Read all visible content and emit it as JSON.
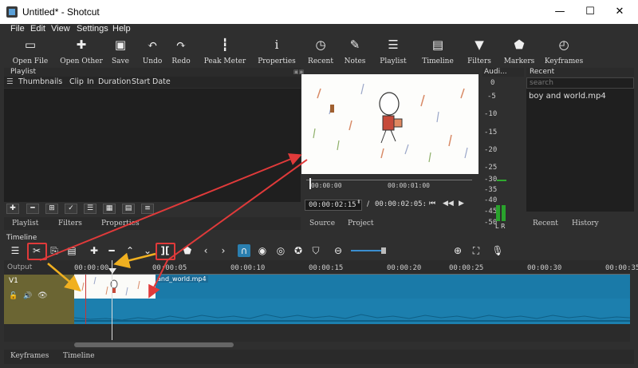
{
  "window": {
    "title": "Untitled* - Shotcut",
    "minimize": "—",
    "maximize": "☐",
    "close": "✕"
  },
  "menu": [
    "File",
    "Edit",
    "View",
    "Settings",
    "Help"
  ],
  "toolbar": [
    {
      "label": "Open File",
      "icon": "▭"
    },
    {
      "label": "Open Other",
      "icon": "✚"
    },
    {
      "label": "Save",
      "icon": "▣"
    },
    {
      "label": "Undo",
      "icon": "↶"
    },
    {
      "label": "Redo",
      "icon": "↷"
    },
    {
      "label": "Peak Meter",
      "icon": "┇"
    },
    {
      "label": "Properties",
      "icon": "i"
    },
    {
      "label": "Recent",
      "icon": "◷"
    },
    {
      "label": "Notes",
      "icon": "✎"
    },
    {
      "label": "Playlist",
      "icon": "☰"
    },
    {
      "label": "Timeline",
      "icon": "▤"
    },
    {
      "label": "Filters",
      "icon": "▼"
    },
    {
      "label": "Markers",
      "icon": "⬟"
    },
    {
      "label": "Keyframes",
      "icon": "◴"
    }
  ],
  "playlist": {
    "title": "Playlist",
    "columns": [
      "Thumbnails",
      "Clip",
      "In",
      "Duration",
      "Start",
      "Date"
    ],
    "tabs": [
      "Playlist",
      "Filters",
      "Properties"
    ]
  },
  "player": {
    "ruler_left": "00:00:00",
    "ruler_right": "00:00:01:00",
    "position": "00:00:02:15",
    "separator": "/",
    "duration": "00:00:02:05:",
    "tabs": [
      "Source",
      "Project"
    ]
  },
  "audio": {
    "title": "Audi...",
    "scale": [
      "0",
      "-5",
      "-10",
      "-15",
      "-20",
      "-25",
      "-30",
      "-35",
      "-40",
      "-45",
      "-50"
    ],
    "channels": "L R"
  },
  "recent": {
    "title": "Recent",
    "search_placeholder": "search",
    "items": [
      "boy and world.mp4"
    ],
    "tabs": [
      "Recent",
      "History"
    ]
  },
  "timeline": {
    "title": "Timeline",
    "output_label": "Output",
    "track_label": "V1",
    "ruler": [
      "00:00:00",
      "00:00:05",
      "00:00:10",
      "00:00:15",
      "00:00:20",
      "00:00:25",
      "00:00:30",
      "00:00:35"
    ],
    "clip_name": "and_world.mp4",
    "bottom_tabs": [
      "Keyframes",
      "Timeline"
    ]
  },
  "colors": {
    "accent": "#1f85b0",
    "highlight": "#e03a3a",
    "arrow_yellow": "#f0b020",
    "track_bg": "#6b6533"
  }
}
